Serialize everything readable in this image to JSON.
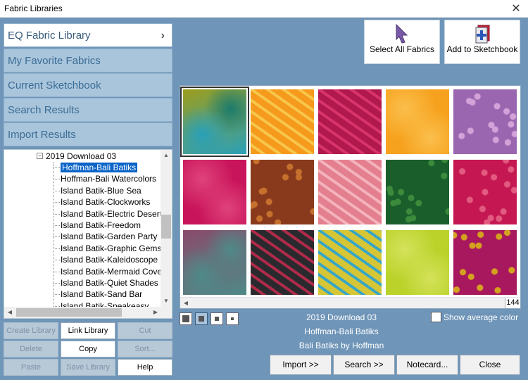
{
  "window": {
    "title": "Fabric Libraries",
    "close_glyph": "✕"
  },
  "tabs": [
    {
      "label": "EQ Fabric Library",
      "chevron": "›"
    },
    {
      "label": "My Favorite Fabrics"
    },
    {
      "label": "Current Sketchbook"
    },
    {
      "label": "Search Results"
    },
    {
      "label": "Import Results"
    }
  ],
  "tree": {
    "parent": {
      "label": "2019 Download 03",
      "expander": "−"
    },
    "items": [
      {
        "label": "Hoffman-Bali Batiks",
        "selected": true
      },
      {
        "label": "Hoffman-Bali Watercolors"
      },
      {
        "label": "Island Batik-Blue Sea"
      },
      {
        "label": "Island Batik-Clockworks"
      },
      {
        "label": "Island Batik-Electric Desert"
      },
      {
        "label": "Island Batik-Freedom"
      },
      {
        "label": "Island Batik-Garden Party"
      },
      {
        "label": "Island Batik-Graphic Gems"
      },
      {
        "label": "Island Batik-Kaleidoscope"
      },
      {
        "label": "Island Batik-Mermaid Cove"
      },
      {
        "label": "Island Batik-Quiet Shades"
      },
      {
        "label": "Island Batik-Sand Bar"
      },
      {
        "label": "Island Batik-Speakeasy"
      }
    ],
    "scroll_icons": {
      "up": "▲",
      "down": "▼",
      "left": "◀",
      "right": "▶"
    }
  },
  "library_buttons": {
    "create": "Create Library",
    "link": "Link Library",
    "cut": "Cut",
    "delete": "Delete",
    "copy": "Copy",
    "sort": "Sort...",
    "paste": "Paste",
    "save": "Save Library",
    "help": "Help"
  },
  "toolbar": {
    "select_all": "Select All Fabrics",
    "select_all_icon": "cursor-arrow-icon",
    "add_sketchbook": "Add to Sketchbook",
    "add_sketchbook_icon": "sketchbook-add-icon"
  },
  "fabrics": [
    {
      "name": "swatch-1",
      "colors": [
        "#9c9d1c",
        "#2aa0b8",
        "#1c7a6a"
      ],
      "pattern": "tie-dye",
      "selected": true
    },
    {
      "name": "swatch-2",
      "colors": [
        "#f59a1c",
        "#f7c64a"
      ],
      "pattern": "leaves"
    },
    {
      "name": "swatch-3",
      "colors": [
        "#b0184e",
        "#d8346a"
      ],
      "pattern": "leaves"
    },
    {
      "name": "swatch-4",
      "colors": [
        "#f6a21e",
        "#fbbf4c"
      ],
      "pattern": "mottled"
    },
    {
      "name": "swatch-5",
      "colors": [
        "#9a66b0",
        "#d3a2d8"
      ],
      "pattern": "dots"
    },
    {
      "name": "swatch-6",
      "colors": [
        "#c8145a",
        "#e0437c"
      ],
      "pattern": "mottled"
    },
    {
      "name": "swatch-7",
      "colors": [
        "#8a3a1c",
        "#c6702e"
      ],
      "pattern": "dots"
    },
    {
      "name": "swatch-8",
      "colors": [
        "#e37f8e",
        "#f4b3bc"
      ],
      "pattern": "leaves"
    },
    {
      "name": "swatch-9",
      "colors": [
        "#1a5e2c",
        "#3c8a3c"
      ],
      "pattern": "dots"
    },
    {
      "name": "swatch-10",
      "colors": [
        "#c51852",
        "#e25a80"
      ],
      "pattern": "dots"
    },
    {
      "name": "swatch-11",
      "colors": [
        "#8a4a6a",
        "#4e8a88"
      ],
      "pattern": "tie-dye"
    },
    {
      "name": "swatch-12",
      "colors": [
        "#2a2a2e",
        "#b02a4a"
      ],
      "pattern": "leaves"
    },
    {
      "name": "swatch-13",
      "colors": [
        "#d6c636",
        "#3aa6c4"
      ],
      "pattern": "leaves"
    },
    {
      "name": "swatch-14",
      "colors": [
        "#bad22a",
        "#d4e25a"
      ],
      "pattern": "mottled"
    },
    {
      "name": "swatch-15",
      "colors": [
        "#a8185e",
        "#d4a21e"
      ],
      "pattern": "dots"
    }
  ],
  "grid": {
    "total_count": "144",
    "scroll_left": "◀"
  },
  "info": {
    "collection": "2019 Download 03",
    "library": "Hoffman-Bali Batiks",
    "subtitle": "Bali Batiks by Hoffman"
  },
  "show_average_color": {
    "label": "Show average color",
    "checked": false
  },
  "actions": {
    "import": "Import      >>",
    "search": "Search      >>",
    "notecard": "Notecard...",
    "close": "Close"
  },
  "colors": {
    "background": "#6f95b8",
    "tab_bg": "#a9c5dc",
    "tab_text": "#3c6d94",
    "selection": "#0a64c8"
  }
}
